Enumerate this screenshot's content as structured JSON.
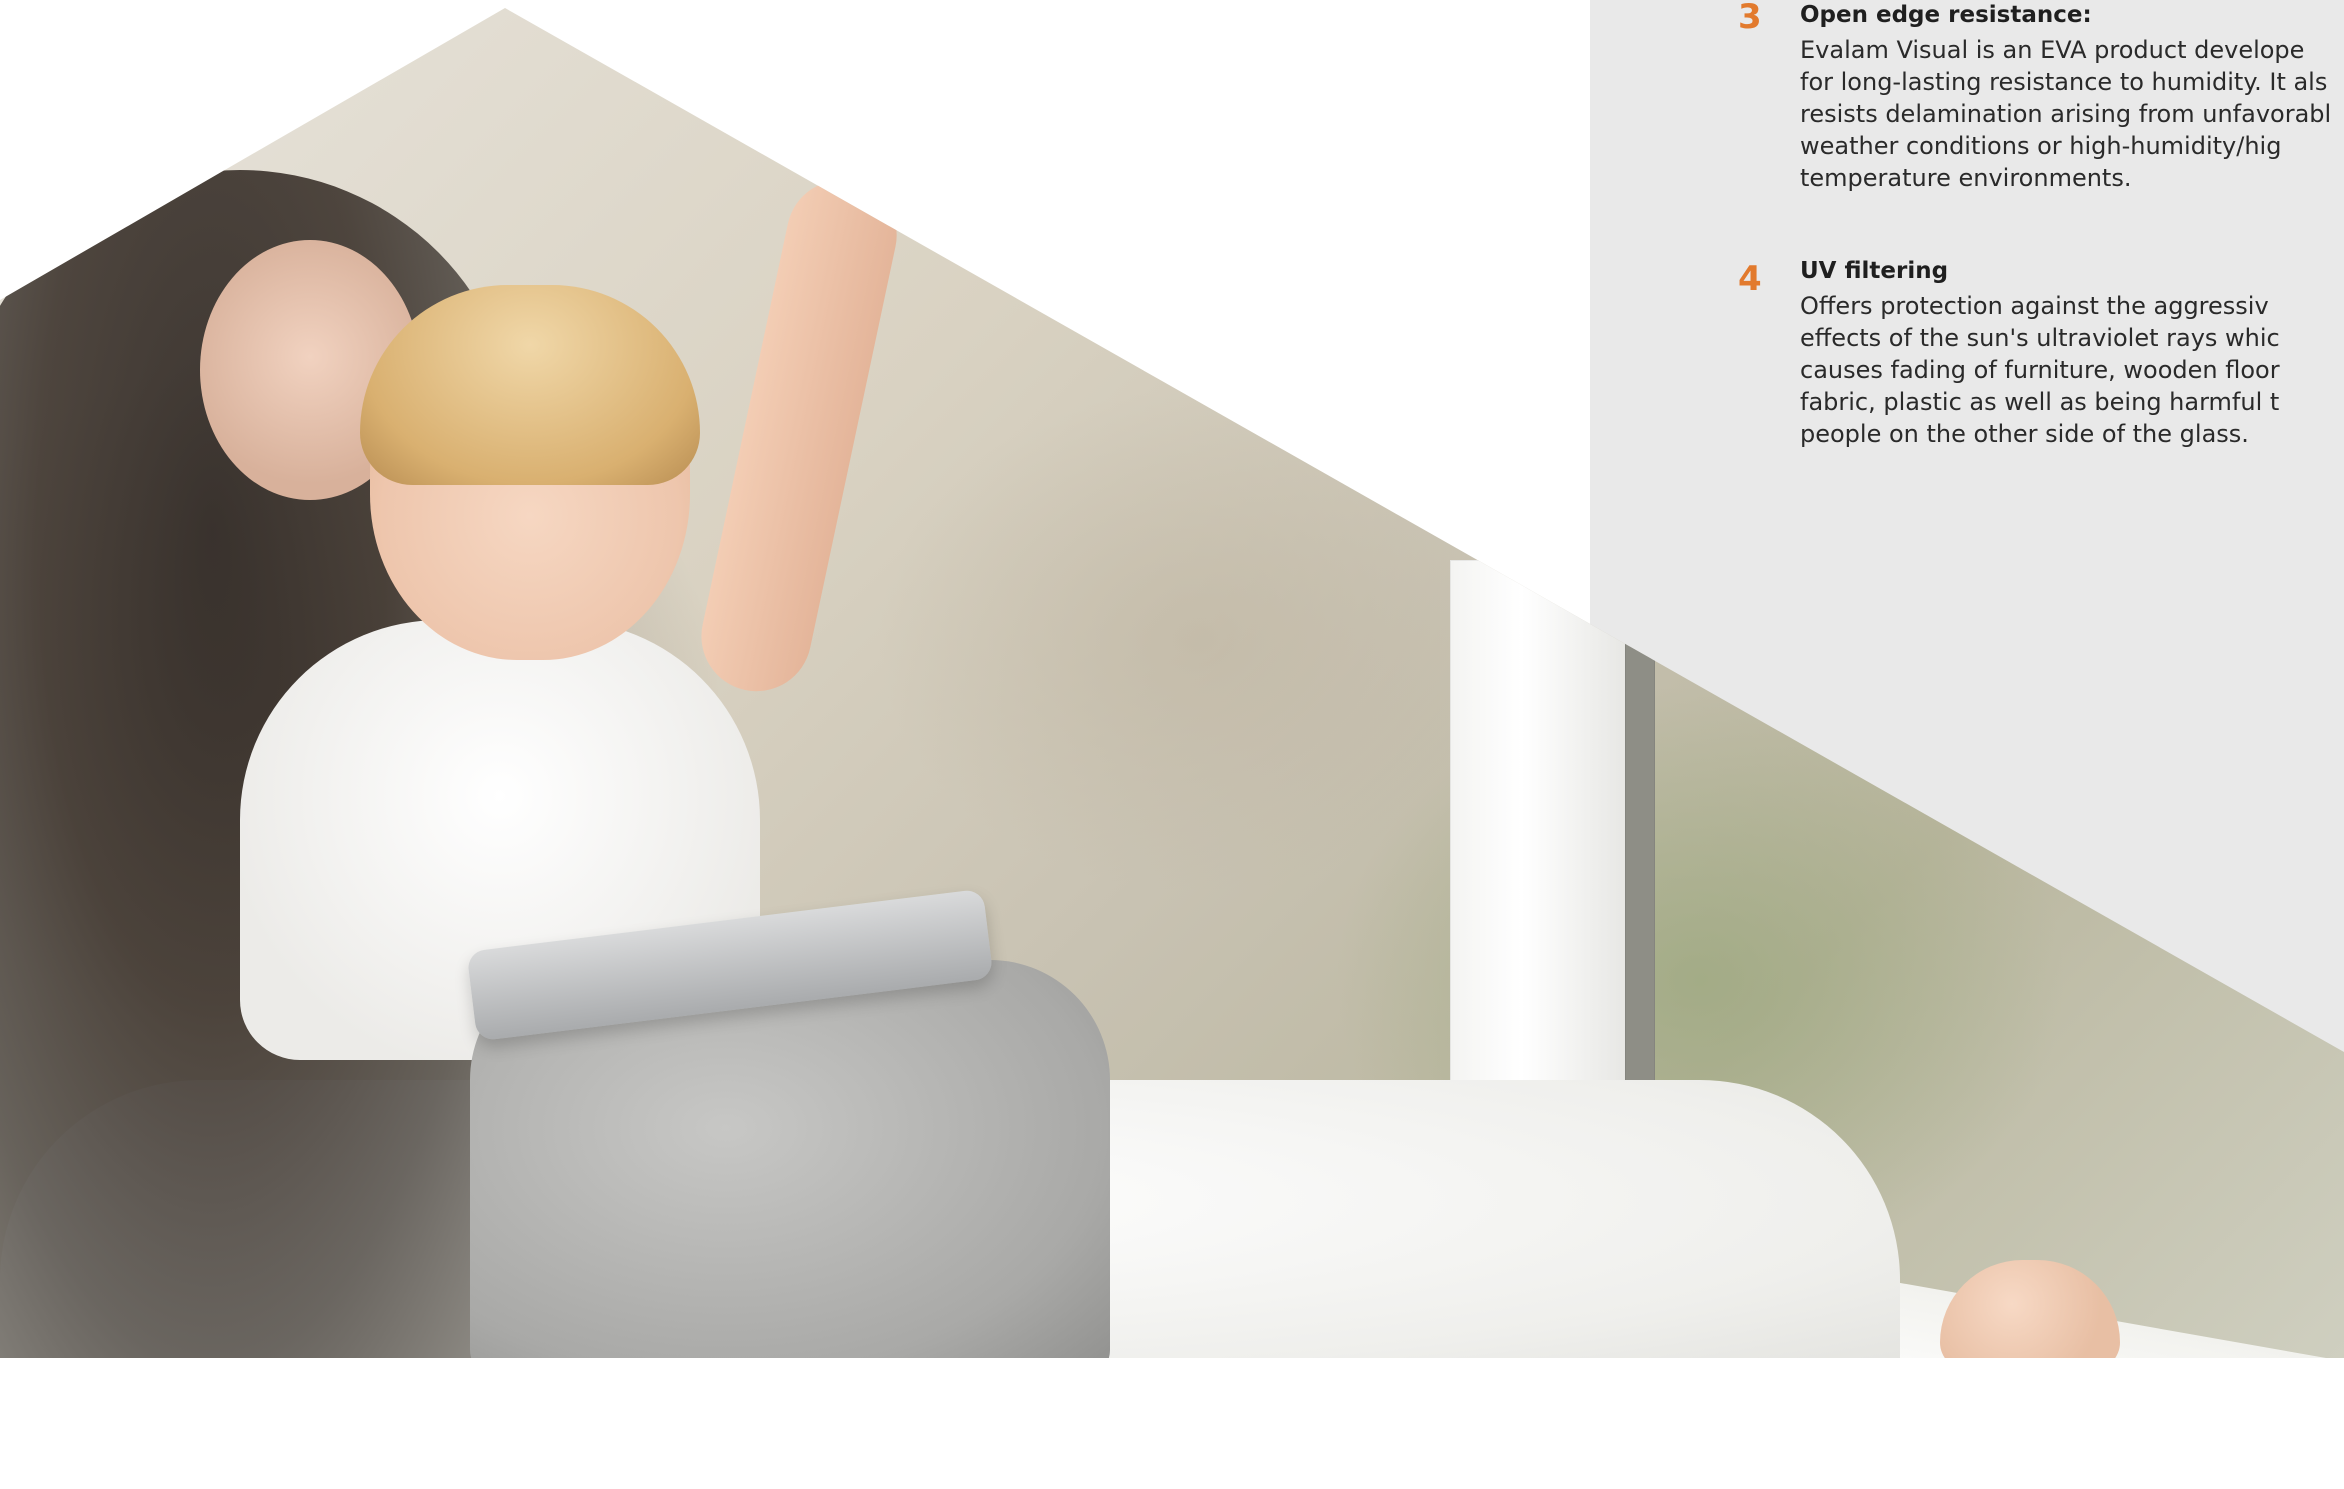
{
  "items": [
    {
      "number": "3",
      "title": "Open edge resistance:",
      "lines": [
        "Evalam Visual is an EVA product develope",
        "for long-lasting resistance to humidity. It als",
        "resists delamination arising from unfavorabl",
        "weather conditions or high-humidity/hig",
        "temperature environments."
      ]
    },
    {
      "number": "4",
      "title": "UV filtering",
      "lines": [
        "Offers protection against the aggressiv",
        "effects of the sun's ultraviolet rays whic",
        "causes fading of furniture, wooden floor",
        "fabric, plastic as well as being harmful t",
        "people on the other side of the glass."
      ]
    }
  ],
  "colors": {
    "accent": "#e27a2d",
    "panel": "#e9e9e9",
    "text": "#2a2a2a"
  }
}
